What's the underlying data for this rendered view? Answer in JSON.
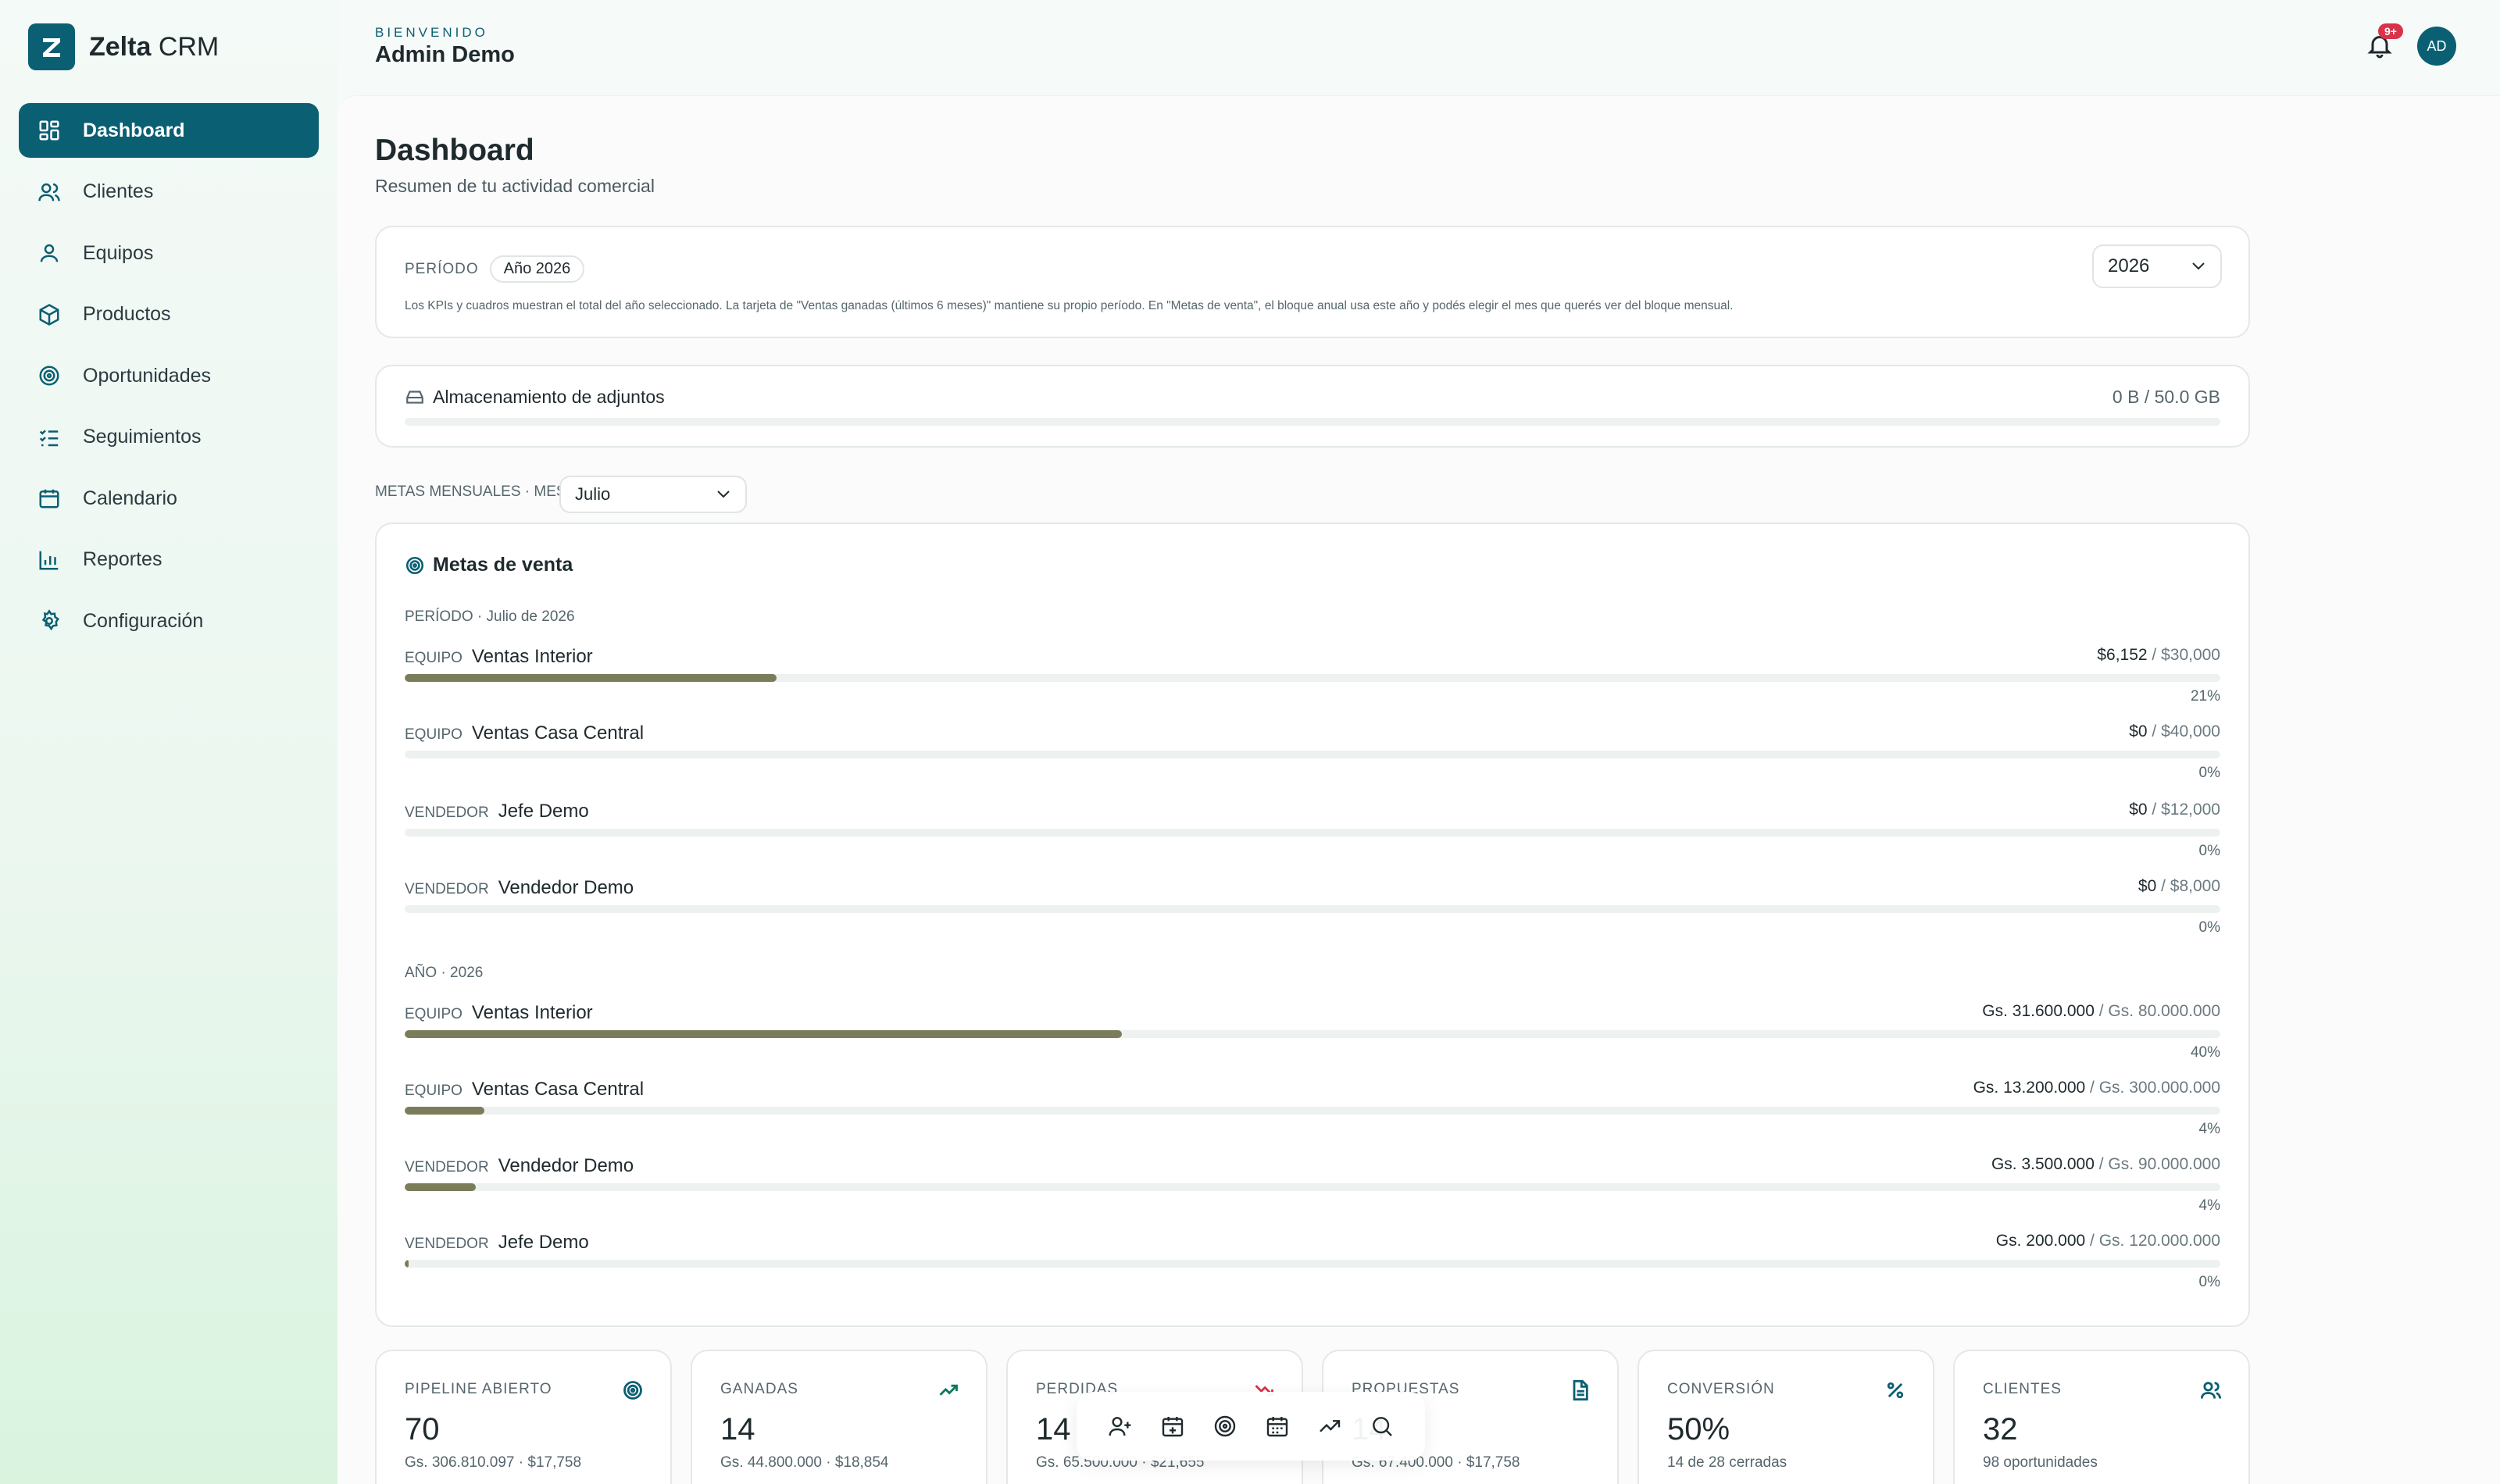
{
  "app": {
    "brand_main": "Zelta",
    "brand_sub": "CRM"
  },
  "sidebar": {
    "items": [
      {
        "label": "Dashboard",
        "icon": "dashboard-icon"
      },
      {
        "label": "Clientes",
        "icon": "users-icon"
      },
      {
        "label": "Equipos",
        "icon": "user-icon"
      },
      {
        "label": "Productos",
        "icon": "box-icon"
      },
      {
        "label": "Oportunidades",
        "icon": "target-icon"
      },
      {
        "label": "Seguimientos",
        "icon": "checklist-icon"
      },
      {
        "label": "Calendario",
        "icon": "calendar-icon"
      },
      {
        "label": "Reportes",
        "icon": "bar-chart-icon"
      },
      {
        "label": "Configuración",
        "icon": "gear-icon"
      }
    ]
  },
  "header": {
    "welcome": "BIENVENIDO",
    "user_name": "Admin Demo",
    "notif_badge": "9+",
    "avatar": "AD"
  },
  "page": {
    "title": "Dashboard",
    "subtitle": "Resumen de tu actividad comercial"
  },
  "period": {
    "label": "PERÍODO",
    "pill": "Año 2026",
    "select_value": "2026",
    "note": "Los KPIs y cuadros muestran el total del año seleccionado. La tarjeta de \"Ventas ganadas (últimos 6 meses)\" mantiene su propio período. En \"Metas de venta\", el bloque anual usa este año y podés elegir el mes que querés ver del bloque mensual."
  },
  "storage": {
    "label": "Almacenamiento de adjuntos",
    "value": "0 B / 50.0 GB",
    "fraction": 0
  },
  "monthly": {
    "label": "METAS MENSUALES · MES",
    "select_value": "Julio"
  },
  "goals": {
    "title": "Metas de venta",
    "monthly_period": "PERÍODO · Julio de 2026",
    "monthly_rows": [
      {
        "kind": "EQUIPO",
        "name": "Ventas Interior",
        "actual": "$6,152",
        "goal": " / $30,000",
        "pct": "21%",
        "fraction": 0.205
      },
      {
        "kind": "EQUIPO",
        "name": "Ventas Casa Central",
        "actual": "$0",
        "goal": " / $40,000",
        "pct": "0%",
        "fraction": 0
      },
      {
        "kind": "VENDEDOR",
        "name": "Jefe Demo",
        "actual": "$0",
        "goal": " / $12,000",
        "pct": "0%",
        "fraction": 0
      },
      {
        "kind": "VENDEDOR",
        "name": "Vendedor Demo",
        "actual": "$0",
        "goal": " / $8,000",
        "pct": "0%",
        "fraction": 0
      }
    ],
    "annual_period": "AÑO · 2026",
    "annual_rows": [
      {
        "kind": "EQUIPO",
        "name": "Ventas Interior",
        "actual": "Gs. 31.600.000",
        "goal": " / Gs. 80.000.000",
        "pct": "40%",
        "fraction": 0.395
      },
      {
        "kind": "EQUIPO",
        "name": "Ventas Casa Central",
        "actual": "Gs. 13.200.000",
        "goal": " / Gs. 300.000.000",
        "pct": "4%",
        "fraction": 0.044
      },
      {
        "kind": "VENDEDOR",
        "name": "Vendedor Demo",
        "actual": "Gs. 3.500.000",
        "goal": " / Gs. 90.000.000",
        "pct": "4%",
        "fraction": 0.039
      },
      {
        "kind": "VENDEDOR",
        "name": "Jefe Demo",
        "actual": "Gs. 200.000",
        "goal": " / Gs. 120.000.000",
        "pct": "0%",
        "fraction": 0.002
      }
    ]
  },
  "kpis": [
    {
      "label": "PIPELINE ABIERTO",
      "value": "70",
      "sub": "Gs. 306.810.097 · $17,758",
      "icon": "target-icon",
      "color": "#0b5f73"
    },
    {
      "label": "GANADAS",
      "value": "14",
      "sub": "Gs. 44.800.000 · $18,854",
      "icon": "trend-up-icon",
      "color": "#0b7a5c"
    },
    {
      "label": "PERDIDAS",
      "value": "14",
      "sub": "Gs. 65.500.000 · $21,655",
      "icon": "trend-down-icon",
      "color": "#d9334a"
    },
    {
      "label": "PROPUESTAS",
      "value": "14",
      "sub": "Gs. 67.400.000 · $17,758",
      "icon": "document-icon",
      "color": "#0b5f73"
    },
    {
      "label": "CONVERSIÓN",
      "value": "50%",
      "sub": "14 de 28 cerradas",
      "icon": "percent-icon",
      "color": "#0b5f73"
    },
    {
      "label": "CLIENTES",
      "value": "32",
      "sub": "98 oportunidades",
      "icon": "users-icon",
      "color": "#0b5f73"
    }
  ],
  "quick_actions": [
    {
      "icon": "add-user-icon"
    },
    {
      "icon": "calendar-add-icon"
    },
    {
      "icon": "target-icon"
    },
    {
      "icon": "calendar-icon"
    },
    {
      "icon": "trend-up-icon"
    },
    {
      "icon": "search-icon"
    }
  ]
}
